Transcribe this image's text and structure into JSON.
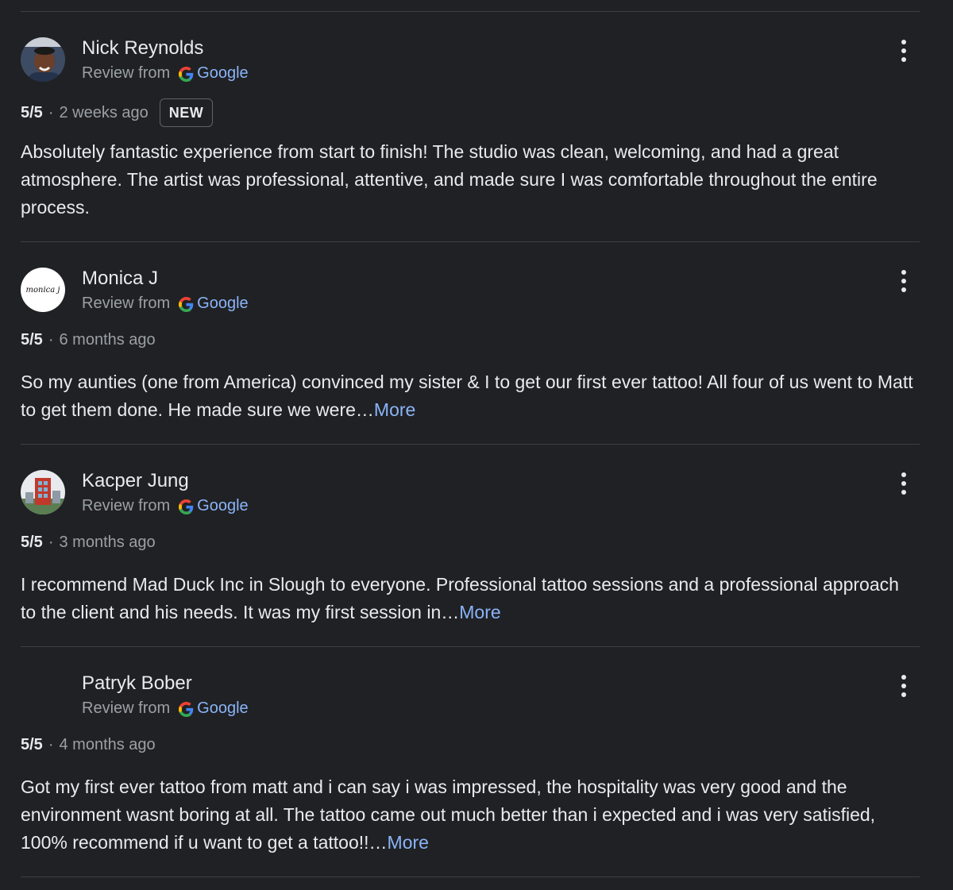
{
  "reviews": [
    {
      "name": "Nick Reynolds",
      "source_prefix": "Review from",
      "source_name": "Google",
      "rating": "5/5",
      "time": "2 weeks ago",
      "badge": "NEW",
      "text": "Absolutely fantastic experience from start to finish! The studio was clean, welcoming, and had a great atmosphere. The artist was professional, attentive, and made sure I was comfortable throughout the entire process.",
      "more": ""
    },
    {
      "name": "Monica J",
      "source_prefix": "Review from",
      "source_name": "Google",
      "rating": "5/5",
      "time": "6 months ago",
      "badge": "",
      "avatar_text": "monica j",
      "text": "So my aunties (one from America) convinced my sister & I to get our first ever tattoo! All four of us went to Matt to get them done. He made sure we were…",
      "more": "More"
    },
    {
      "name": "Kacper Jung",
      "source_prefix": "Review from",
      "source_name": "Google",
      "rating": "5/5",
      "time": "3 months ago",
      "badge": "",
      "text": "I recommend Mad Duck Inc in Slough to everyone. Professional tattoo sessions and a professional approach to the client and his needs. It was my first session in…",
      "more": "More"
    },
    {
      "name": "Patryk Bober",
      "source_prefix": "Review from",
      "source_name": "Google",
      "rating": "5/5",
      "time": "4 months ago",
      "badge": "",
      "text": "Got my first ever tattoo from matt and i can say i was impressed, the hospitality was very good and the environment wasnt boring at all. The tattoo came out much better than i expected and i was very satisfied, 100% recommend if u want to get a tattoo!!…",
      "more": "More"
    }
  ],
  "separator": "·",
  "icons": {
    "menu": "more-vert-icon",
    "google": "google-g-icon"
  },
  "colors": {
    "background": "#202124",
    "link": "#8ab4f8",
    "text": "#e8eaed",
    "muted": "#9aa0a6"
  }
}
